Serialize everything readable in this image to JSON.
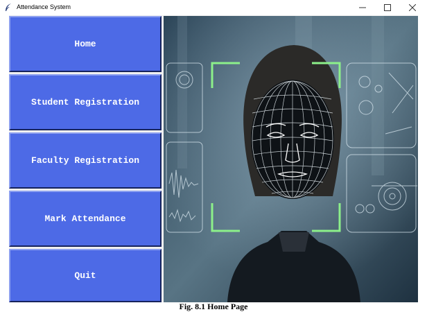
{
  "window": {
    "title": "Attendance System",
    "controls": {
      "minimize": "–",
      "maximize": "☐",
      "close": "✕"
    }
  },
  "menu": {
    "items": [
      {
        "label": "Home"
      },
      {
        "label": "Student Registration"
      },
      {
        "label": "Faculty Registration"
      },
      {
        "label": "Mark Attendance"
      },
      {
        "label": "Quit"
      }
    ]
  },
  "hero": {
    "icon": "face-recognition-illustration"
  },
  "caption": "Fig. 8.1 Home Page",
  "colors": {
    "button": "#4d6ae6",
    "button_text": "#ffffff",
    "scan_frame": "#8cf08a"
  }
}
